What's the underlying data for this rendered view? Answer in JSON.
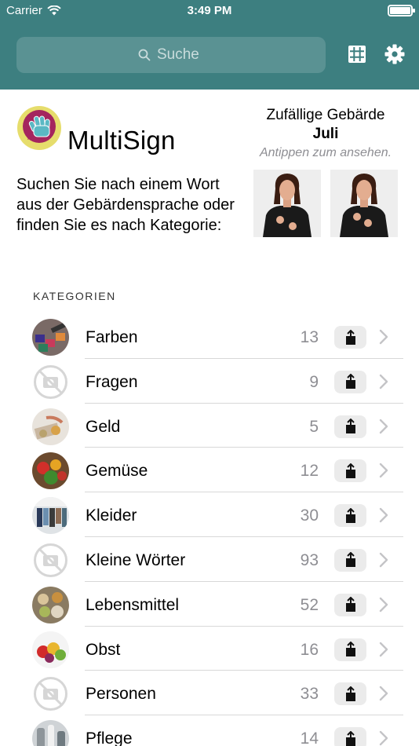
{
  "status_bar": {
    "carrier": "Carrier",
    "time": "3:49 PM"
  },
  "search": {
    "placeholder": "Suche"
  },
  "header_icons": [
    "grid-icon",
    "gear-icon"
  ],
  "brand": {
    "name": "MultiSign"
  },
  "intro_text": "Suchen Sie nach einem Wort aus der Gebärdensprache oder finden Sie es nach Kategorie:",
  "random_sign": {
    "title": "Zufällige Gebärde",
    "word": "Juli",
    "hint": "Antippen zum ansehen."
  },
  "categories_header": "KATEGORIEN",
  "categories": [
    {
      "name": "Farben",
      "count": "13",
      "thumb": "colors"
    },
    {
      "name": "Fragen",
      "count": "9",
      "thumb": "no-image"
    },
    {
      "name": "Geld",
      "count": "5",
      "thumb": "money"
    },
    {
      "name": "Gemüse",
      "count": "12",
      "thumb": "vegetables"
    },
    {
      "name": "Kleider",
      "count": "30",
      "thumb": "clothes"
    },
    {
      "name": "Kleine Wörter",
      "count": "93",
      "thumb": "no-image"
    },
    {
      "name": "Lebensmittel",
      "count": "52",
      "thumb": "food"
    },
    {
      "name": "Obst",
      "count": "16",
      "thumb": "fruit"
    },
    {
      "name": "Personen",
      "count": "33",
      "thumb": "no-image"
    },
    {
      "name": "Pflege",
      "count": "14",
      "thumb": "care"
    }
  ],
  "colors": {
    "header": "#3d7f80",
    "search_bg": "#5a9293",
    "count": "#8e8e93"
  }
}
